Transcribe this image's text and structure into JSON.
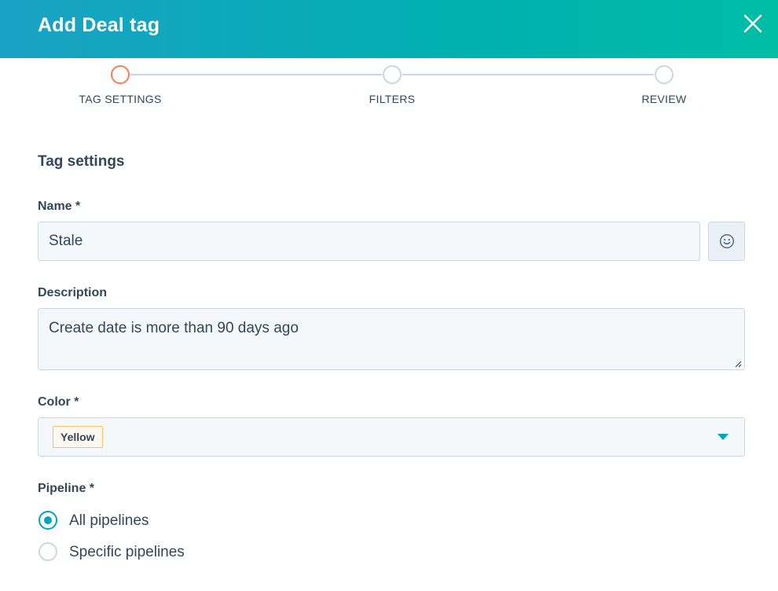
{
  "header": {
    "title": "Add Deal tag"
  },
  "stepper": {
    "steps": [
      {
        "label": "TAG SETTINGS",
        "state": "active"
      },
      {
        "label": "FILTERS",
        "state": "inactive"
      },
      {
        "label": "REVIEW",
        "state": "inactive"
      }
    ]
  },
  "form": {
    "section_title": "Tag settings",
    "name": {
      "label": "Name *",
      "value": "Stale",
      "emoji_icon": "smiley-face-icon"
    },
    "description": {
      "label": "Description",
      "value": "Create date is more than 90 days ago"
    },
    "color": {
      "label": "Color *",
      "value": "Yellow",
      "chip_border": "#f5c26b",
      "chip_bg": "#fef8f0"
    },
    "pipeline": {
      "label": "Pipeline *",
      "options": [
        {
          "label": "All pipelines",
          "checked": true
        },
        {
          "label": "Specific pipelines",
          "checked": false
        }
      ]
    }
  },
  "colors": {
    "accent_teal": "#00a4bd",
    "active_step": "#ff7a59",
    "header_gradient_start": "#1aa2c4",
    "header_gradient_end": "#00bda5"
  }
}
